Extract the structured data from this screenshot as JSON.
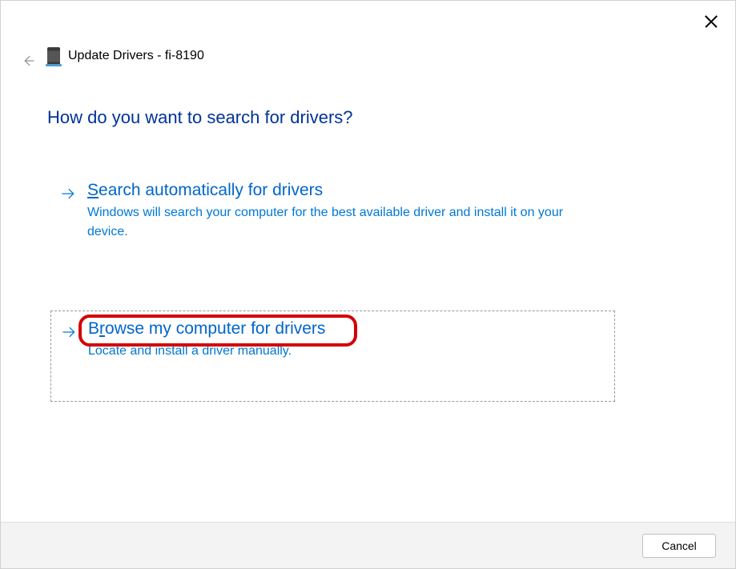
{
  "header": {
    "title": "Update Drivers - fi-8190"
  },
  "heading": "How do you want to search for drivers?",
  "options": {
    "auto": {
      "title_pre": "S",
      "title_rest": "earch automatically for drivers",
      "desc": "Windows will search your computer for the best available driver and install it on your device."
    },
    "browse": {
      "title_pre": "B",
      "title_mnemonic": "r",
      "title_rest": "owse my computer for drivers",
      "desc": "Locate and install a driver manually."
    }
  },
  "footer": {
    "cancel_label": "Cancel"
  }
}
